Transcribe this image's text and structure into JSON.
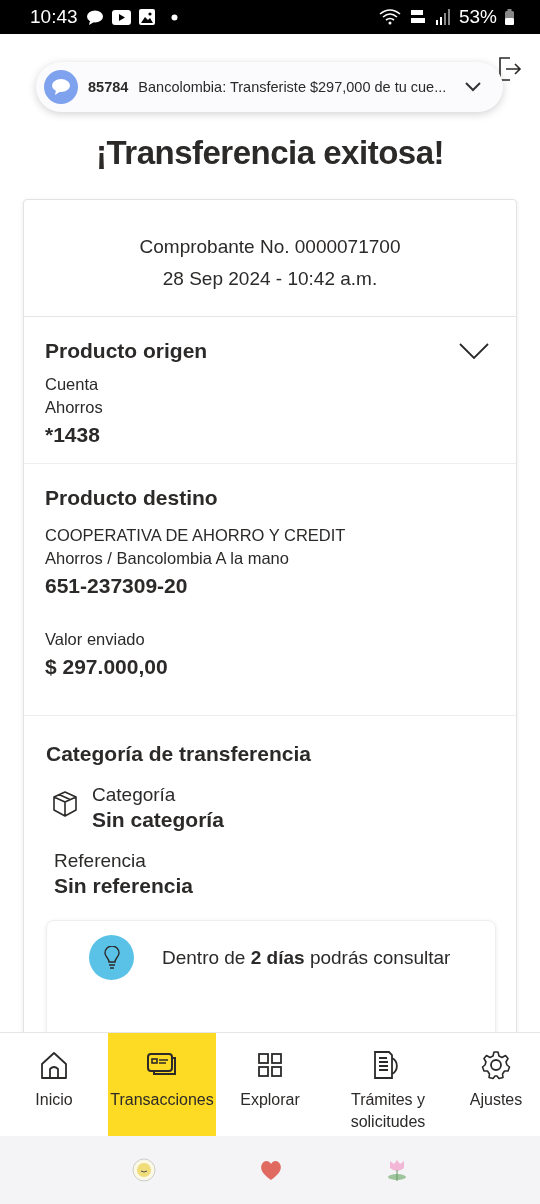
{
  "status_bar": {
    "time": "10:43",
    "battery": "53%"
  },
  "notification": {
    "sender": "85784",
    "message": "Bancolombia: Transferiste $297,000 de tu cue..."
  },
  "title": "¡Transferencia exitosa!",
  "receipt": {
    "number": "Comprobante No. 0000071700",
    "date": "28 Sep 2024 - 10:42 a.m."
  },
  "origin": {
    "heading": "Producto origen",
    "expanded": false,
    "type_lines": [
      "Cuenta",
      "Ahorros"
    ],
    "account": "*1438"
  },
  "destination": {
    "heading": "Producto destino",
    "name": "COOPERATIVA DE AHORRO Y CREDIT",
    "type": "Ahorros / Bancolombia A la mano",
    "account": "651-237309-20",
    "amount_label": "Valor enviado",
    "amount": "$ 297.000,00"
  },
  "category": {
    "heading": "Categoría de transferencia",
    "category_label": "Categoría",
    "category_value": "Sin categoría",
    "reference_label": "Referencia",
    "reference_value": "Sin referencia"
  },
  "tip": {
    "text": "Dentro de **2 días** podrás consultar"
  },
  "nav": [
    {
      "label": "Inicio",
      "selected": false
    },
    {
      "label": "Transacciones",
      "selected": true
    },
    {
      "label": "Explorar",
      "selected": false
    },
    {
      "label": "Trámites y solicitudes",
      "selected": false
    },
    {
      "label": "Ajustes",
      "selected": false
    }
  ]
}
